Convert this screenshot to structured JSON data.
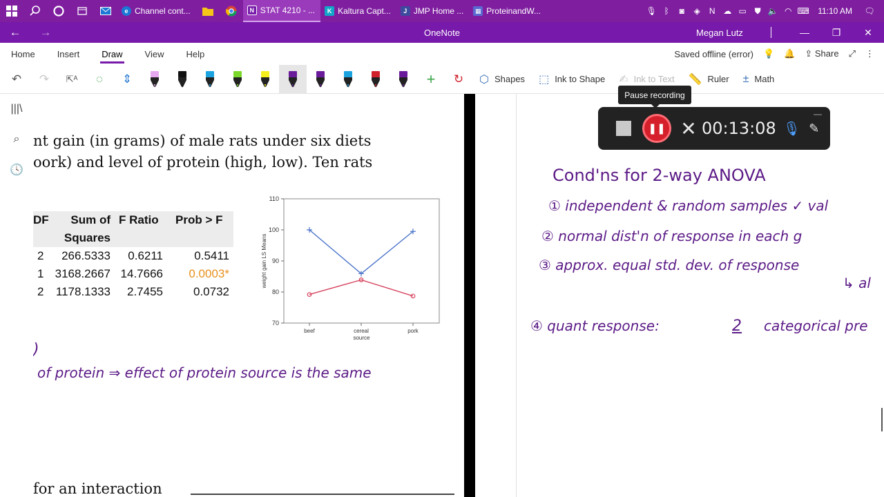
{
  "taskbar": {
    "tasks": [
      {
        "label": "Channel cont...",
        "icon": "edge-icon",
        "color": "#1b78d4"
      },
      {
        "label": "STAT 4210 - ...",
        "icon": "onenote-icon",
        "color": "#7719aa"
      },
      {
        "label": "Kaltura Capt...",
        "icon": "kaltura-icon",
        "color": "#13a6c9"
      },
      {
        "label": "JMP Home ...",
        "icon": "jmp-icon",
        "color": "#3d4a9e"
      },
      {
        "label": "ProteinandW...",
        "icon": "jmp-data-icon",
        "color": "#5a6ad1"
      }
    ],
    "clock": "11:10 AM"
  },
  "titlebar": {
    "app_title": "OneNote",
    "user": "Megan Lutz"
  },
  "ribbon": {
    "tabs": [
      "Home",
      "Insert",
      "Draw",
      "View",
      "Help"
    ],
    "active_tab": "Draw",
    "status": "Saved offline (error)",
    "share": "Share"
  },
  "toolbar": {
    "shapes": "Shapes",
    "ink_to_shape": "Ink to Shape",
    "ink_to_text": "Ink to Text",
    "ruler": "Ruler",
    "math": "Math",
    "pens": [
      {
        "color": "#e6a8ee",
        "name": "pink-highlighter-icon"
      },
      {
        "color": "#111111",
        "name": "black-pen-icon"
      },
      {
        "color": "#1ba3df",
        "name": "blue-pen-icon"
      },
      {
        "color": "#7bd82b",
        "name": "green-pen-icon"
      },
      {
        "color": "#f5ef1d",
        "name": "yellow-highlighter-icon"
      },
      {
        "color": "#6a1b9a",
        "name": "purple-pen-icon"
      },
      {
        "color": "#6a1b9a",
        "name": "purple-galaxy-pen-icon"
      },
      {
        "color": "#1ba3df",
        "name": "blue-galaxy-pen-icon"
      },
      {
        "color": "#d0202a",
        "name": "red-pen-icon"
      },
      {
        "color": "#6a1b9a",
        "name": "purple-glitter-pen-icon"
      }
    ]
  },
  "recorder": {
    "tooltip": "Pause recording",
    "time": "00:13:08"
  },
  "slide": {
    "line1": "nt gain (in grams) of male rats under six diets",
    "line2": "oork) and level of protein (high, low). Ten rats",
    "bottom_text": "for an interaction"
  },
  "anova": {
    "headers": {
      "df": "DF",
      "ss_line1": "Sum of",
      "ss_line2": "Squares",
      "f": "F Ratio",
      "p": "Prob > F"
    },
    "rows": [
      {
        "df": "2",
        "ss": "266.5333",
        "f": "0.6211",
        "p": "0.5411",
        "significant": false
      },
      {
        "df": "1",
        "ss": "3168.2667",
        "f": "14.7666",
        "p": "0.0003*",
        "significant": true
      },
      {
        "df": "2",
        "ss": "1178.1333",
        "f": "2.7455",
        "p": "0.0732",
        "significant": false
      }
    ]
  },
  "chart_data": {
    "type": "line",
    "categories": [
      "beef",
      "cereal",
      "pork"
    ],
    "xlabel": "source",
    "ylabel": "weight gain LS Means",
    "ylim": [
      70,
      110
    ],
    "yticks": [
      70,
      80,
      90,
      100,
      110
    ],
    "grid": false,
    "legend": "none",
    "series": [
      {
        "values": [
          100.0,
          85.9,
          99.5
        ],
        "color": "#4a73c9",
        "marker": "+"
      },
      {
        "values": [
          79.2,
          83.9,
          78.7
        ],
        "color": "#d6435e",
        "marker": "o"
      }
    ]
  },
  "ink_left": {
    "paren": ")",
    "line": "of protein ⇒ effect of protein source is the same"
  },
  "ink_right": {
    "title": "Cond'ns for 2-way ANOVA",
    "c1": "① independent & random samples ✓   val",
    "c2": "② normal dist'n of response in each g",
    "c3": "③ approx. equal std. dev. of response",
    "c3b": "↳ al",
    "c4a": "④ quant response:",
    "c4b": "2",
    "c4c": "categorical pre"
  }
}
